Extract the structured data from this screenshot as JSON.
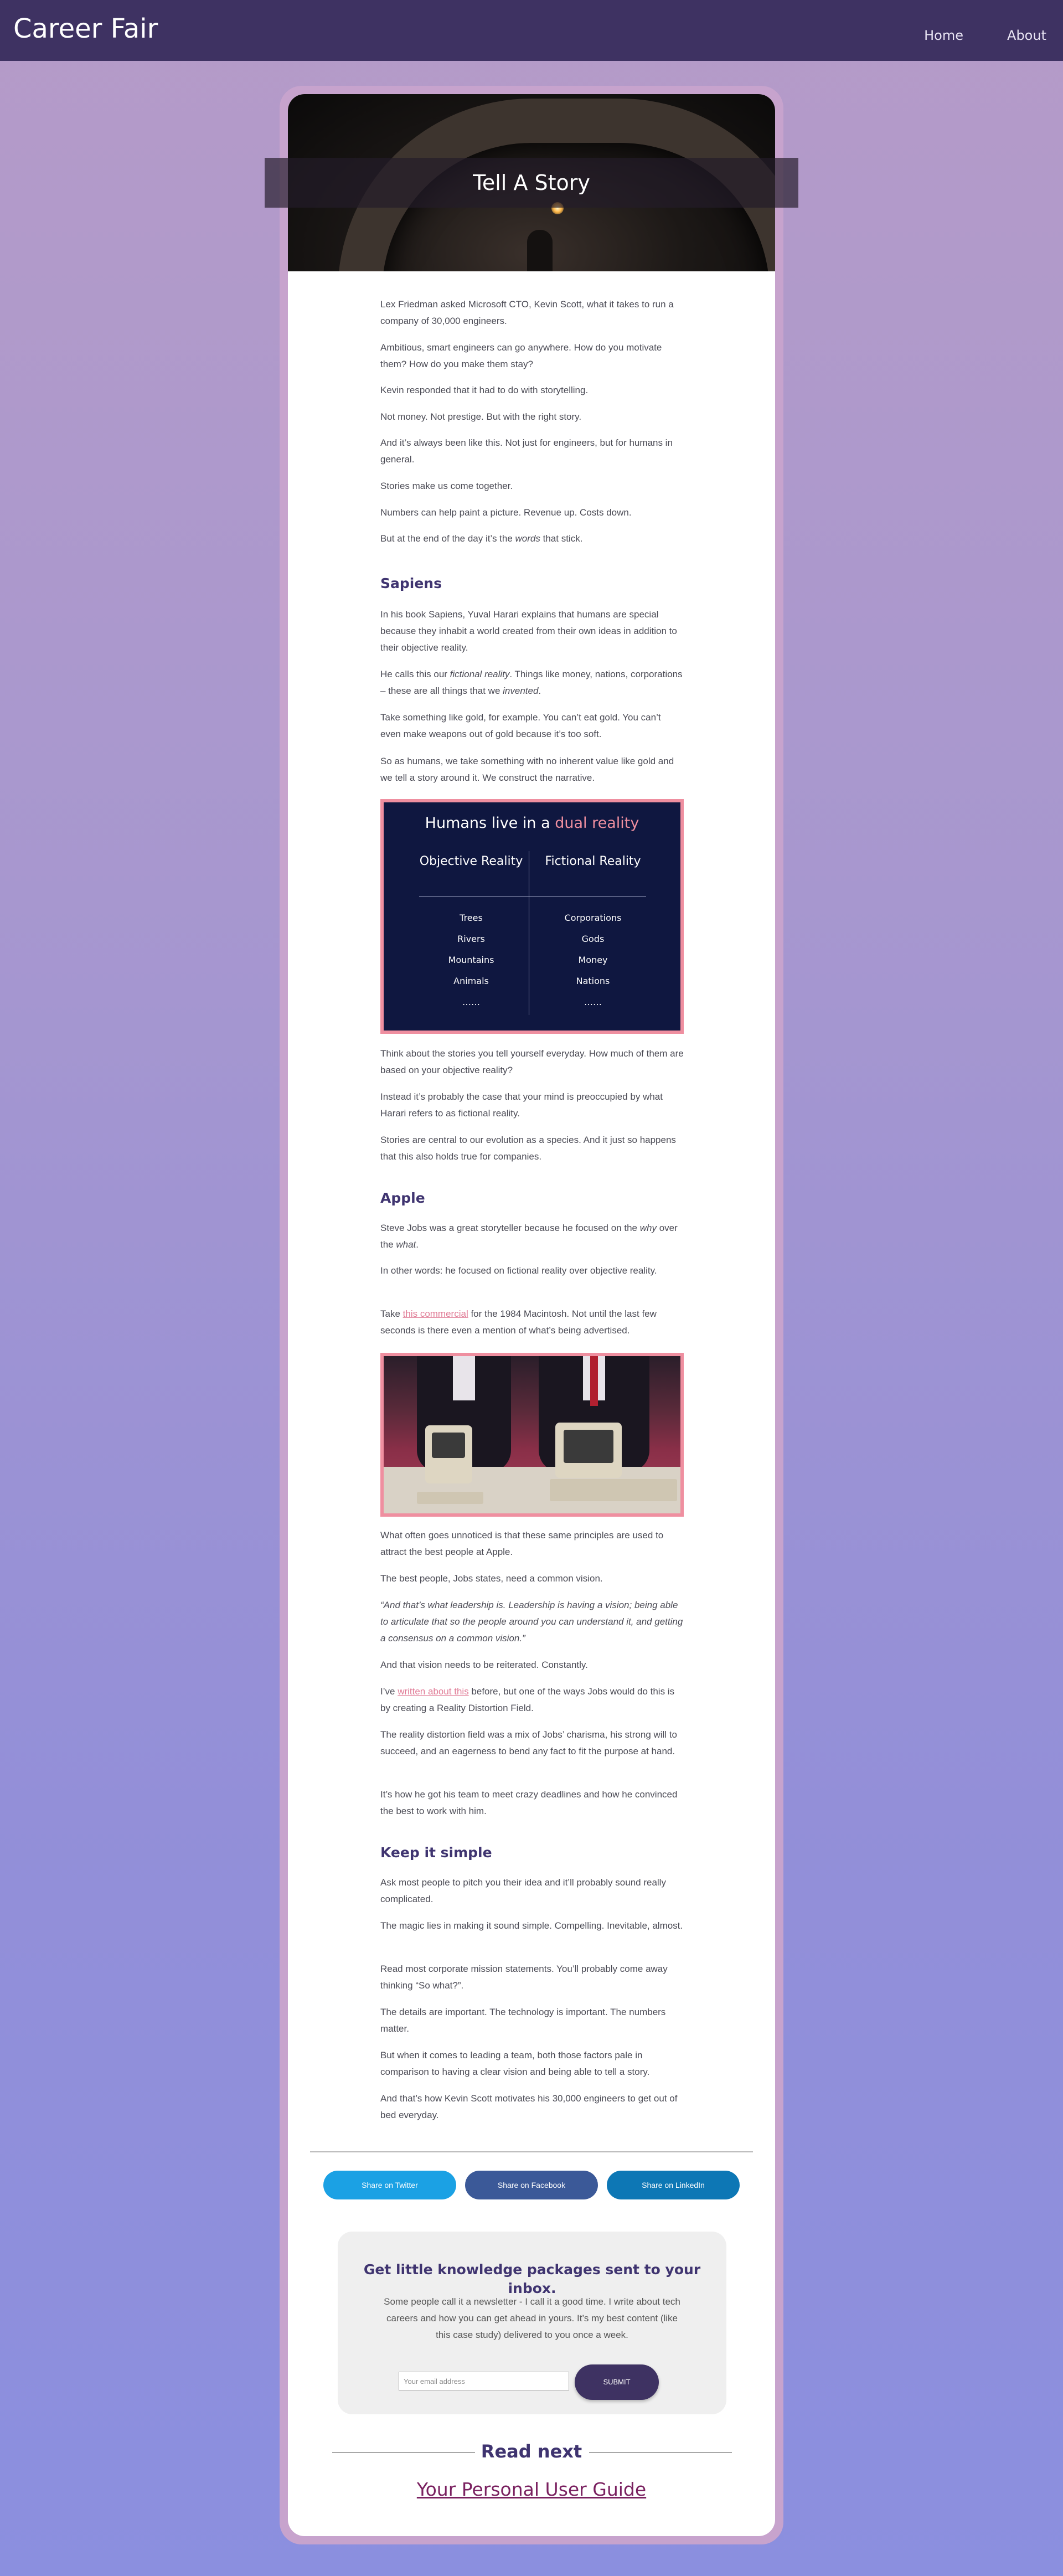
{
  "header": {
    "brand": "Career Fair",
    "nav": [
      "Home",
      "About"
    ]
  },
  "article": {
    "title": "Tell A Story",
    "intro": [
      "Lex Friedman asked Microsoft CTO, Kevin Scott, what it takes to run a company of 30,000 engineers.",
      "Ambitious, smart engineers can go anywhere. How do you motivate them? How do you make them stay?",
      "Kevin responded that it had to do with storytelling.",
      "Not money. Not prestige. But with the right story.",
      "And it’s always been like this. Not just for engineers, but for humans in general.",
      "Stories make us come together.",
      "Numbers can help paint a picture. Revenue up. Costs down."
    ],
    "intro_last_before": "But at the end of the day it’s the ",
    "intro_last_em": "words",
    "intro_last_after": " that stick.",
    "sapiens_heading": "Sapiens",
    "sapiens_p1": "In his book Sapiens, Yuval Harari explains that humans are special because they inhabit a world created from their own ideas in addition to their objective reality.",
    "sapiens_p2_a": "He calls this our ",
    "sapiens_p2_em": "fictional reality",
    "sapiens_p2_b": ". Things like money, nations, corporations – these are all things that we ",
    "sapiens_p2_em2": "invented",
    "sapiens_p2_c": ".",
    "sapiens_p3": "Take something like gold, for example. You can’t eat gold. You can’t even make weapons out of gold because it’s too soft.",
    "sapiens_p4": "So as humans, we take something with no inherent value like gold and we tell a story around it. We construct the narrative.",
    "after_dual": [
      "Think about the stories you tell yourself everyday. How much of them are based on your objective reality?",
      "Instead it’s probably the case that your mind is preoccupied by what Harari refers to as fictional reality.",
      "Stories are central to our evolution as a species. And it just so happens that this also holds true for companies."
    ],
    "apple_heading": "Apple",
    "apple_p1_a": "Steve Jobs was a great storyteller because he focused on the ",
    "apple_p1_em": "why",
    "apple_p1_b": " over the ",
    "apple_p1_em2": "what",
    "apple_p1_c": ".",
    "apple_p2": "In other words: he focused on fictional reality over objective reality.",
    "apple_p3_a": "Take ",
    "apple_p3_link": "this commercial",
    "apple_p3_b": " for the 1984 Macintosh. Not until the last few seconds is there even a mention of what’s being advertised.",
    "after_img": [
      "What often goes unnoticed is that these same principles are used to attract the best people at Apple.",
      "The best people, Jobs states, need a common vision."
    ],
    "quote": "“And that’s what leadership is. Leadership is having a vision; being able to articulate that so the people around you can understand it, and getting a consensus on a common vision.”",
    "after_quote": "And that vision needs to be reiterated. Constantly.",
    "rdf_a": "I’ve ",
    "rdf_link": "written about this",
    "rdf_b": " before, but one of the ways Jobs would do this is by creating a Reality Distortion Field.",
    "rdf_p2": "The reality distortion field was a mix of Jobs’ charisma, his strong will to succeed, and an eagerness to bend any fact to fit the purpose at hand.",
    "rdf_p3": "It’s how he got his team to meet crazy deadlines and how he convinced the best to work with him.",
    "simple_heading": "Keep it simple",
    "simple": [
      "Ask most people to pitch you their idea and it’ll probably sound really complicated.",
      "The magic lies in making it sound simple. Compelling. Inevitable, almost.",
      "Read most corporate mission statements. You’ll probably come away thinking “So what?”.",
      "The details are important. The technology is important. The numbers matter.",
      "But when it comes to leading a team, both those factors pale in comparison to having a clear vision and being able to tell a story.",
      "And that’s how Kevin Scott motivates his 30,000 engineers to get out of bed everyday."
    ]
  },
  "dual_reality": {
    "title_a": "Humans live in a ",
    "title_accent": "dual reality",
    "left_head": "Objective Reality",
    "right_head": "Fictional Reality",
    "left_items": [
      "Trees",
      "Rivers",
      "Mountains",
      "Animals",
      "……"
    ],
    "right_items": [
      "Corporations",
      "Gods",
      "Money",
      "Nations",
      "……"
    ],
    "accent_color": "#ef8fa0",
    "bg_color": "#0f1740"
  },
  "share": {
    "twitter": "Share on Twitter",
    "facebook": "Share on Facebook",
    "linkedin": "Share on LinkedIn"
  },
  "newsletter": {
    "title": "Get little knowledge packages sent to your inbox.",
    "body": "Some people call it a newsletter - I call it a good time. I write about tech careers and how you can get ahead in yours. It’s my best content (like this case study) delivered to you once a week.",
    "placeholder": "Your email address",
    "submit": "SUBMIT"
  },
  "read_next": {
    "heading": "Read next",
    "link": "Your Personal User Guide"
  },
  "colors": {
    "header_bg": "#3e3262",
    "heading": "#3f3470",
    "link": "#e07a95"
  }
}
